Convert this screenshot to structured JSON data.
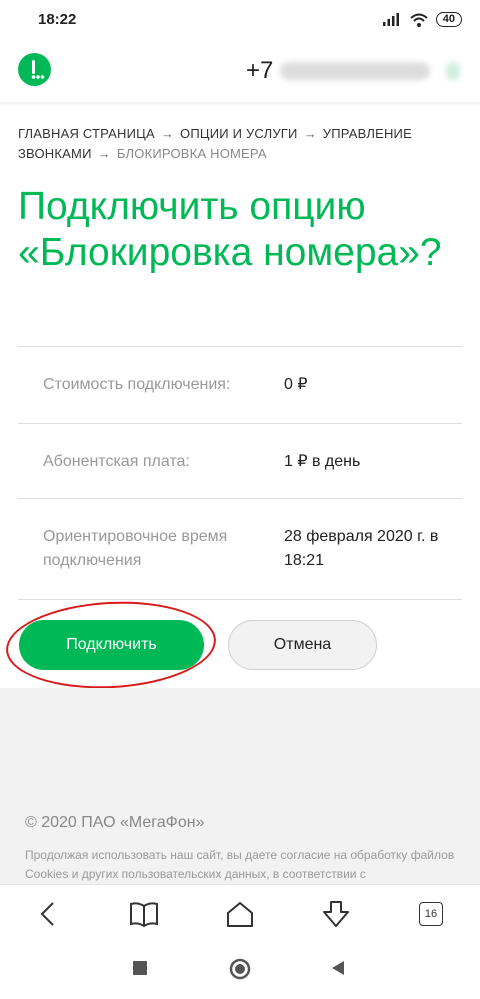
{
  "status": {
    "time": "18:22",
    "battery": "40"
  },
  "header": {
    "phone_prefix": "+7"
  },
  "breadcrumb": {
    "items": [
      "Главная страница",
      "Опции и услуги",
      "Управление звонками"
    ],
    "current": "Блокировка номера",
    "separator": "→"
  },
  "title": "Подключить опцию «Блокировка номера»?",
  "details": [
    {
      "label": "Стоимость подключения:",
      "value": "0 ₽"
    },
    {
      "label": "Абонентская плата:",
      "value": "1 ₽ в день"
    },
    {
      "label": "Ориентировочное время подключения",
      "value": "28 февраля 2020 г. в 18:21"
    }
  ],
  "actions": {
    "connect": "Подключить",
    "cancel": "Отмена"
  },
  "footer": {
    "copyright": "© 2020 ПАО «МегаФон»",
    "note": "Продолжая использовать наш сайт, вы даете согласие на обработку файлов Cookies и других пользовательских данных, в соответствии с"
  },
  "browser": {
    "tabs_count": "16"
  },
  "colors": {
    "accent": "#00b956",
    "highlight": "#d71a1a"
  }
}
